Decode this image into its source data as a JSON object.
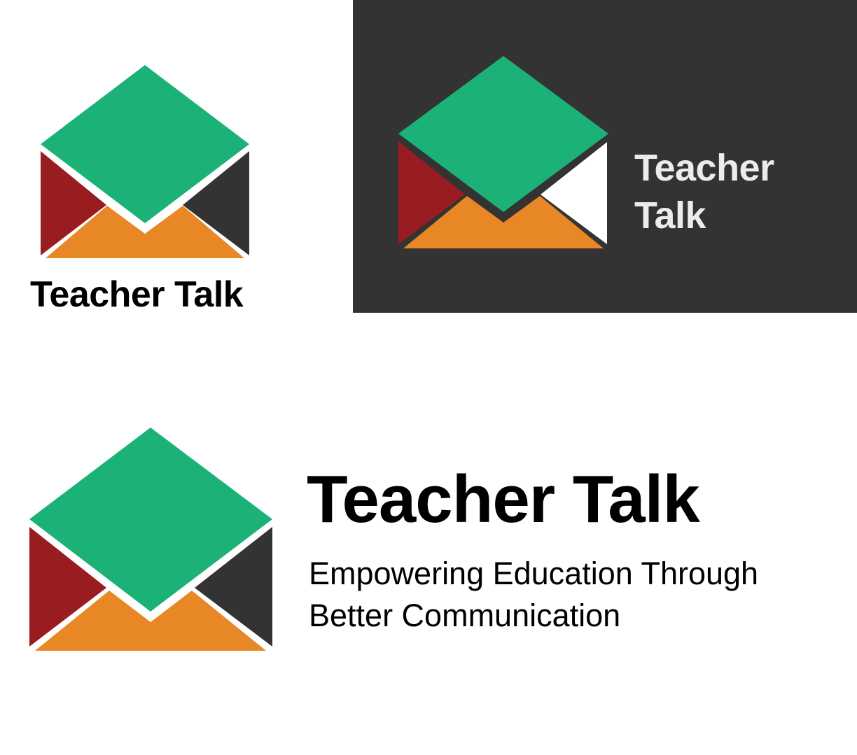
{
  "brand": {
    "name": "Teacher Talk",
    "name_line1": "Teacher",
    "name_line2": "Talk",
    "tagline_line1": "Empowering Education Through",
    "tagline_line2": "Better Communication"
  },
  "colors": {
    "green": "#1bb177",
    "red": "#981c20",
    "orange": "#e88725",
    "charcoal": "#333333",
    "white": "#ffffff",
    "dark_background": "#333333"
  },
  "icons": [
    "envelope-logo-icon"
  ]
}
